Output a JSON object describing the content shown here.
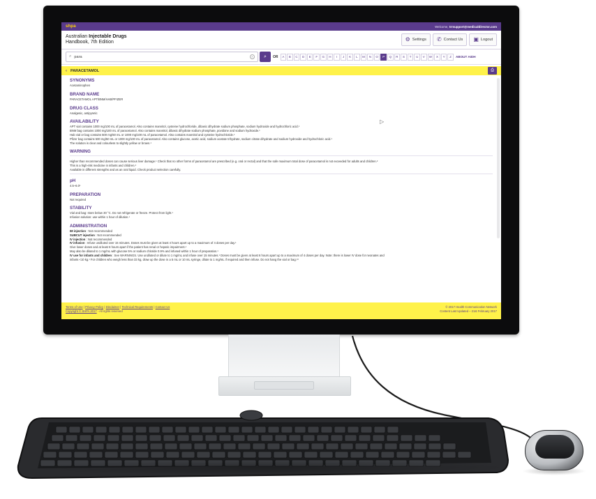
{
  "app": {
    "logo": "shpa",
    "welcome_prefix": "Welcome,",
    "welcome_user": "trrsupport@medicaldirector.com",
    "title_line1_prefix": "Australian ",
    "title_line1_bold": "Injectable Drugs",
    "title_line2": "Handbook, 7th Edition"
  },
  "header": {
    "settings": "Settings",
    "contact": "Contact Us",
    "logout": "Logout"
  },
  "search": {
    "value": "para",
    "or_label": "OR",
    "letters": [
      "A",
      "B",
      "C",
      "D",
      "E",
      "F",
      "G",
      "H",
      "I",
      "J",
      "K",
      "L",
      "M",
      "N",
      "O",
      "P",
      "Q",
      "R",
      "S",
      "T",
      "U",
      "V",
      "W",
      "X",
      "Y",
      "Z"
    ],
    "active_letter": "P",
    "about": "ABOUT AIDH"
  },
  "drug": {
    "name": "PARACETAMOL"
  },
  "sections": {
    "synonyms": {
      "title": "SYNONYMS",
      "lines": [
        "Acetaminophen"
      ]
    },
    "brand": {
      "title": "BRAND NAME",
      "lines": [
        "PARACETAMOL APT/BNM/HAB/PFIZER"
      ]
    },
    "class": {
      "title": "DRUG CLASS",
      "lines": [
        "Analgesic, antipyretic"
      ]
    },
    "availability": {
      "title": "AVAILABILITY",
      "lines": [
        "APT vial contains 1000 mg/100 mL of paracetamol. Also contains mannitol, cysteine hydrochloride, dibasic dihydrate sodium phosphate, sodium hydroxide and hydrochloric acid.¹",
        "BNM bag contains 1000 mg/100 mL of paracetamol. Also contains mannitol, dibasic dihydrate sodium phosphate, povidone and sodium hydroxide.¹",
        "Hab vial or bag contains 500 mg/50 mL or 1000 mg/100 mL of paracetamol. Also contains mannitol and cysteine hydrochloride.¹",
        "Pfizer bag contains 500 mg/50 mL or 1000 mg/100 mL of paracetamol. Also contains glucose, acetic acid, sodium acetate trihydrate, sodium citrate dihydrate and sodium hydroxide and hydrochloric acid.¹",
        "The solution is clear and colourless to slightly yellow or brown.¹"
      ]
    },
    "warning": {
      "title": "WARNING",
      "lines": [
        "Higher than recommended doses can cause serious liver damage.¹ Check that no other forms of paracetamol are prescribed (e.g. oral or rectal) and that the safe maximum total dose of paracetamol is not exceeded for adults and children.²",
        "This is a high-risk medicine in infants and children.²",
        "Available in different strengths and as an oral liquid. Check product selection carefully."
      ]
    },
    "ph": {
      "title": "pH",
      "lines": [
        "4.5–6.0¹"
      ]
    },
    "preparation": {
      "title": "PREPARATION",
      "lines": [
        "Not required"
      ]
    },
    "stability": {
      "title": "STABILITY",
      "lines": [
        "Vial and bag: store below 30 °C. Do not refrigerate or freeze. Protect from light.¹",
        "Infusion solution: use within 1 hour of dilution.¹"
      ]
    },
    "administration": {
      "title": "ADMINISTRATION",
      "rows": [
        {
          "label": "IM injection",
          "text": " : Not recommended"
        },
        {
          "label": "SUBCUT injection",
          "text": " : Not recommended"
        },
        {
          "label": "IV injection",
          "text": " : Not recommended"
        },
        {
          "label": "IV infusion",
          "text": " : Infuse undiluted over 15 minutes. Doses must be given at least 4 hours apart up to a maximum of 4 doses per day.¹"
        },
        {
          "label": "",
          "text": "Give lower doses and at least 6 hours apart if the patient has renal or hepatic impairment.¹"
        },
        {
          "label": "",
          "text": "May also be diluted to 1 mg/mL with glucose 5% or sodium chloride 0.9% and infused within 1 hour of preparation.¹"
        },
        {
          "label": "IV use for infants and children",
          "text": " : See WARNINGS. Use undiluted or dilute to 1 mg/mL and infuse over 15 minutes.¹ Doses must be given at least 6 hours apart up to a maximum of 4 doses per day. Note: there is lower IV dose for neonates and"
        },
        {
          "label": "",
          "text": "infants <10 kg.¹ For children who weigh less than 33 kg, draw up the dose in a 5 mL or 10 mL syringe, dilute to 1 mg/mL if required and then infuse. Do not hang the vial or bag.¹³"
        }
      ]
    }
  },
  "footer": {
    "links": [
      "Terms of Use",
      "Privacy Policy",
      "Disclaimer",
      "Technical Requirements",
      "Contact Us"
    ],
    "copyright_link": "Copyright © SHPA 2017",
    "copyright_rest": " - All rights reserved",
    "right_line1": "© 2017 Health Communication Network",
    "right_line2": "Content Last Updated – 21st February 2017"
  }
}
